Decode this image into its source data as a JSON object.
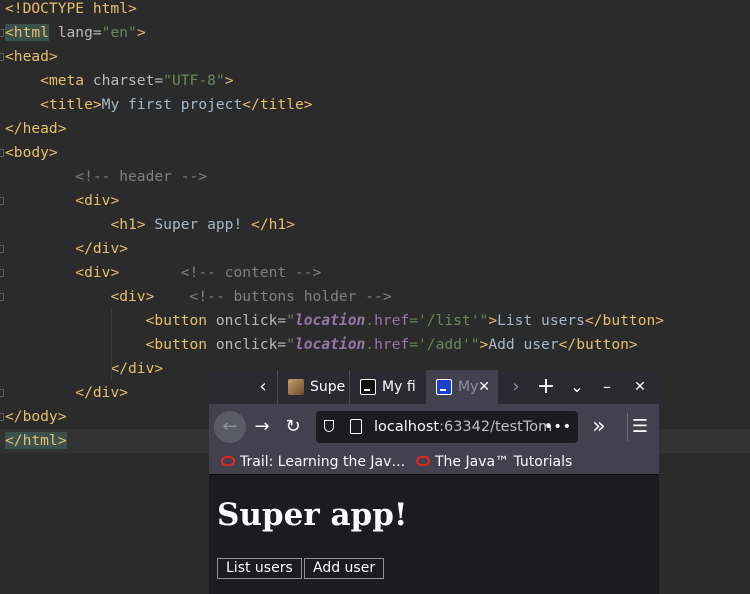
{
  "editor": {
    "lines": [
      {
        "parts": [
          {
            "t": "tag",
            "v": "<!DOCTYPE html>"
          }
        ]
      },
      {
        "parts": [
          {
            "t": "tag",
            "v": "<html",
            "hl": true
          },
          {
            "t": "attr",
            "v": " lang="
          },
          {
            "t": "str",
            "v": "\"en\""
          },
          {
            "t": "tag",
            "v": ">"
          }
        ]
      },
      {
        "parts": [
          {
            "t": "tag",
            "v": "<head>"
          }
        ]
      },
      {
        "parts": [
          {
            "t": "txt",
            "v": "    "
          },
          {
            "t": "tag",
            "v": "<meta"
          },
          {
            "t": "attr",
            "v": " charset="
          },
          {
            "t": "str",
            "v": "\"UTF-8\""
          },
          {
            "t": "tag",
            "v": ">"
          }
        ]
      },
      {
        "parts": [
          {
            "t": "txt",
            "v": "    "
          },
          {
            "t": "tag",
            "v": "<title>"
          },
          {
            "t": "txt",
            "v": "My first project"
          },
          {
            "t": "tag",
            "v": "</title>"
          }
        ]
      },
      {
        "parts": [
          {
            "t": "tag",
            "v": "</head>"
          }
        ]
      },
      {
        "parts": [
          {
            "t": "tag",
            "v": "<body>"
          }
        ]
      },
      {
        "parts": [
          {
            "t": "txt",
            "v": "        "
          },
          {
            "t": "cmt",
            "v": "<!-- header -->"
          }
        ]
      },
      {
        "parts": [
          {
            "t": "txt",
            "v": "        "
          },
          {
            "t": "tag",
            "v": "<div>"
          }
        ]
      },
      {
        "parts": [
          {
            "t": "txt",
            "v": "            "
          },
          {
            "t": "tag",
            "v": "<h1>"
          },
          {
            "t": "txt",
            "v": " Super app! "
          },
          {
            "t": "tag",
            "v": "</h1>"
          }
        ]
      },
      {
        "parts": [
          {
            "t": "txt",
            "v": "        "
          },
          {
            "t": "tag",
            "v": "</div>"
          }
        ]
      },
      {
        "parts": [
          {
            "t": "txt",
            "v": "        "
          },
          {
            "t": "tag",
            "v": "<div>"
          },
          {
            "t": "txt",
            "v": "       "
          },
          {
            "t": "cmt",
            "v": "<!-- content -->"
          }
        ]
      },
      {
        "parts": [
          {
            "t": "txt",
            "v": "            "
          },
          {
            "t": "tag",
            "v": "<div>"
          },
          {
            "t": "txt",
            "v": "    "
          },
          {
            "t": "cmt",
            "v": "<!-- buttons holder -->"
          }
        ]
      },
      {
        "parts": [
          {
            "t": "txt",
            "v": "                "
          },
          {
            "t": "tag",
            "v": "<button"
          },
          {
            "t": "attr",
            "v": " onclick="
          },
          {
            "t": "str",
            "v": "\""
          },
          {
            "t": "kw",
            "v": "location"
          },
          {
            "t": "str",
            "v": "."
          },
          {
            "t": "str2",
            "v": "href"
          },
          {
            "t": "str",
            "v": "='/list'\""
          },
          {
            "t": "tag",
            "v": ">"
          },
          {
            "t": "txt",
            "v": "List users"
          },
          {
            "t": "tag",
            "v": "</button>"
          }
        ]
      },
      {
        "parts": [
          {
            "t": "txt",
            "v": "                "
          },
          {
            "t": "tag",
            "v": "<button"
          },
          {
            "t": "attr",
            "v": " onclick="
          },
          {
            "t": "str",
            "v": "\""
          },
          {
            "t": "kw",
            "v": "location"
          },
          {
            "t": "str",
            "v": "."
          },
          {
            "t": "str2",
            "v": "href"
          },
          {
            "t": "str",
            "v": "='/add'\""
          },
          {
            "t": "tag",
            "v": ">"
          },
          {
            "t": "txt",
            "v": "Add user"
          },
          {
            "t": "tag",
            "v": "</button>"
          }
        ]
      },
      {
        "parts": [
          {
            "t": "txt",
            "v": "            "
          },
          {
            "t": "tag",
            "v": "</div>"
          }
        ]
      },
      {
        "parts": [
          {
            "t": "txt",
            "v": "        "
          },
          {
            "t": "tag",
            "v": "</div>"
          }
        ]
      },
      {
        "parts": [
          {
            "t": "tag",
            "v": "</body>"
          }
        ]
      },
      {
        "parts": [
          {
            "t": "tag",
            "v": "</html>",
            "hl": true
          }
        ]
      }
    ]
  },
  "browser": {
    "tabs": [
      {
        "label": "Supe",
        "icon": "image-favicon-icon"
      },
      {
        "label": "My fi",
        "icon": "intellij-favicon-icon"
      },
      {
        "label": "My",
        "icon": "intellij-favicon-icon",
        "active": true,
        "close": "✕"
      }
    ],
    "scroll_left": "‹",
    "scroll_right": "›",
    "new_tab": "+",
    "list_all": "⌄",
    "minimize": "–",
    "close_window": "✕",
    "nav": {
      "back": "←",
      "forward": "→",
      "reload": "↻",
      "url_host": "localhost",
      "url_rest": ":63342/testTom",
      "page_actions": "•••",
      "overflow": "»",
      "menu": "☰"
    },
    "bookmarks": [
      {
        "label": "Trail: Learning the Jav…"
      },
      {
        "label": "The Java™ Tutorials"
      }
    ],
    "page": {
      "heading": "Super app!",
      "buttons": [
        "List users",
        "Add user"
      ]
    }
  },
  "colors": {
    "editor_bg": "#2b2b2b",
    "tag": "#e8bf6a",
    "string": "#6a8759",
    "comment": "#808080",
    "keyword": "#9876aa",
    "browser_chrome": "#42414d",
    "browser_bg": "#1c1b22"
  }
}
